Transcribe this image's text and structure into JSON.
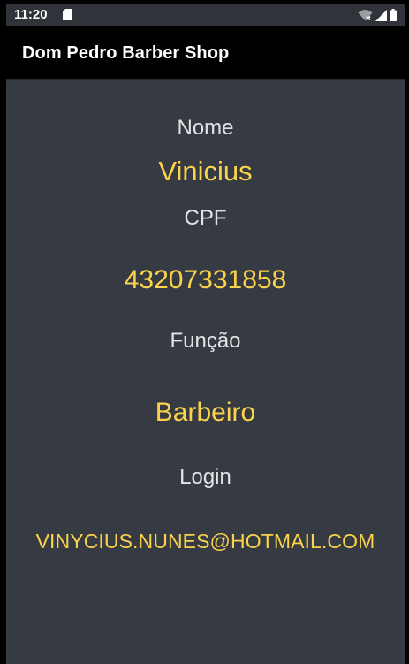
{
  "status_bar": {
    "time": "11:20",
    "icons": [
      "sd-card-icon",
      "wifi-no-internet-icon",
      "cell-signal-icon",
      "battery-icon"
    ]
  },
  "app_bar": {
    "title": "Dom Pedro Barber Shop"
  },
  "profile": {
    "name_label": "Nome",
    "name_value": "Vinicius",
    "cpf_label": "CPF",
    "cpf_value": "43207331858",
    "role_label": "Função",
    "role_value": "Barbeiro",
    "login_label": "Login",
    "login_value": "VINYCIUS.NUNES@HOTMAIL.COM"
  },
  "colors": {
    "background": "#363a42",
    "value_text": "#fbd34a",
    "label_text": "#e2e3e4",
    "app_bar": "#000000"
  }
}
